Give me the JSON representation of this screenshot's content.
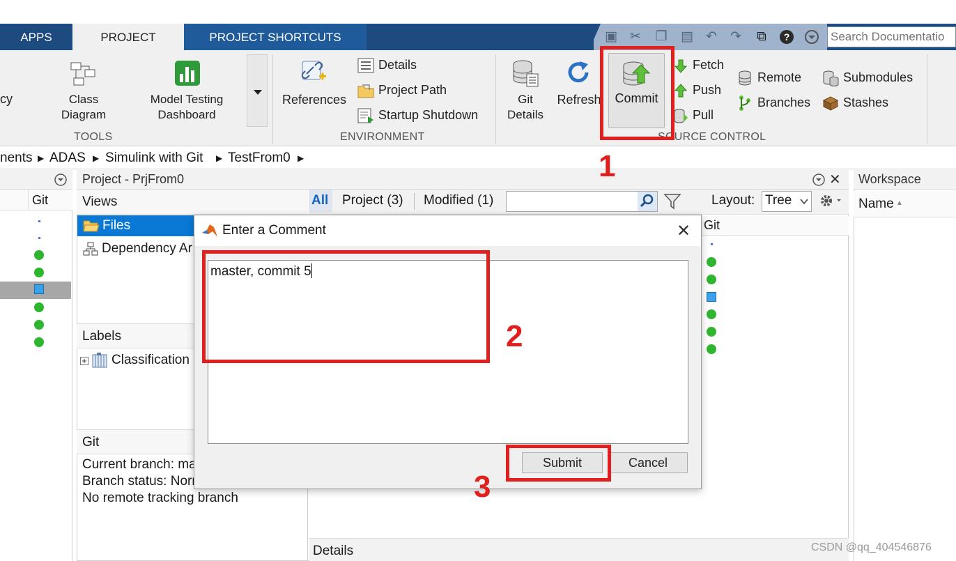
{
  "tabs": {
    "apps": "APPS",
    "project": "PROJECT",
    "shortcuts": "PROJECT SHORTCUTS"
  },
  "search": {
    "placeholder": "Search Documentatio"
  },
  "ribbon": {
    "tools": {
      "cut_label": "cy",
      "class_diagram": [
        "Class",
        "Diagram"
      ],
      "model_testing": [
        "Model Testing",
        "Dashboard"
      ],
      "section": "TOOLS"
    },
    "environment": {
      "references": "References",
      "details": "Details",
      "project_path": "Project Path",
      "startup_shutdown": "Startup Shutdown",
      "section": "ENVIRONMENT"
    },
    "source_control": {
      "git_details": [
        "Git",
        "Details"
      ],
      "refresh": "Refresh",
      "commit": "Commit",
      "fetch": "Fetch",
      "push": "Push",
      "pull": "Pull",
      "remote": "Remote",
      "branches": "Branches",
      "submodules": "Submodules",
      "stashes": "Stashes",
      "section": "SOURCE CONTROL"
    }
  },
  "breadcrumb": [
    "nents",
    "ADAS",
    "Simulink with Git",
    "TestFrom0"
  ],
  "left_panel": {
    "git_header": "Git"
  },
  "project_panel": {
    "title": "Project - PrjFrom0",
    "views_header": "Views",
    "views": [
      "Files",
      "Dependency Ar"
    ],
    "labels_header": "Labels",
    "labels": [
      "Classification"
    ],
    "git_header": "Git",
    "git_info": [
      "Current branch: ma",
      "Branch status: Norn",
      "No remote tracking branch"
    ]
  },
  "files_toolbar": {
    "all": "All",
    "project": "Project (3)",
    "modified": "Modified (1)",
    "layout_label": "Layout:",
    "layout_value": "Tree",
    "git_col": "Git",
    "details": "Details"
  },
  "workspace": {
    "title": "Workspace",
    "name_col": "Name"
  },
  "dialog": {
    "title": "Enter a Comment",
    "comment": "master, commit 5",
    "submit": "Submit",
    "cancel": "Cancel"
  },
  "annotations": [
    "1",
    "2",
    "3"
  ],
  "watermark": "CSDN @qq_404546876",
  "colors": {
    "tabbar": "#1d4a7f",
    "annotation_red": "#e01f1f",
    "selection": "#0a79d6",
    "status_green": "#2fb52f"
  }
}
